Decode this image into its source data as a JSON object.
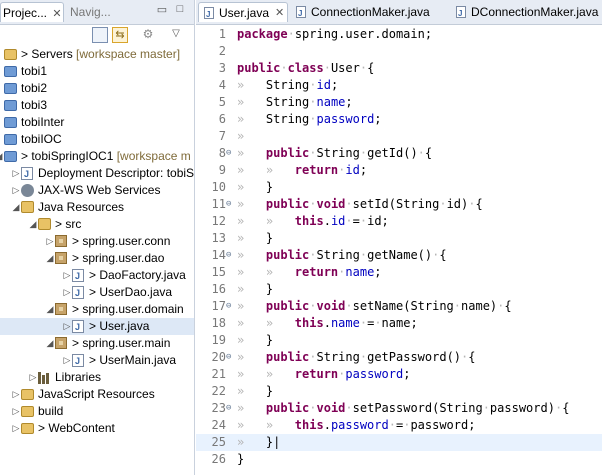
{
  "left_panel": {
    "tabs": [
      {
        "label": "Projec...",
        "active": true
      },
      {
        "label": "Navig...",
        "active": false
      }
    ],
    "tree": [
      {
        "label": "Servers",
        "decoration": "[workspace master]",
        "prefix": ">",
        "indent": 0,
        "icon": "folder-y-icon",
        "twisty": "",
        "selected": false
      },
      {
        "label": "tobi1",
        "indent": 0,
        "icon": "folder-icon",
        "twisty": "",
        "selected": false
      },
      {
        "label": "tobi2",
        "indent": 0,
        "icon": "folder-icon",
        "twisty": "",
        "selected": false
      },
      {
        "label": "tobi3",
        "indent": 0,
        "icon": "folder-icon",
        "twisty": "",
        "selected": false
      },
      {
        "label": "tobiInter",
        "indent": 0,
        "icon": "folder-icon",
        "twisty": "",
        "selected": false
      },
      {
        "label": "tobiIOC",
        "indent": 0,
        "icon": "folder-icon",
        "twisty": "",
        "selected": false
      },
      {
        "label": "tobiSpringIOC1",
        "decoration": "[workspace m",
        "prefix": ">",
        "indent": 0,
        "icon": "folder-icon",
        "twisty": "expanded",
        "selected": false
      },
      {
        "label": "Deployment Descriptor: tobiS",
        "indent": 1,
        "icon": "descriptor-icon",
        "twisty": "collapsed",
        "selected": false
      },
      {
        "label": "JAX-WS Web Services",
        "indent": 1,
        "icon": "gear-icon",
        "twisty": "collapsed",
        "selected": false
      },
      {
        "label": "Java Resources",
        "indent": 1,
        "icon": "java-resources-icon",
        "twisty": "expanded",
        "selected": false
      },
      {
        "label": "src",
        "prefix": ">",
        "indent": 2,
        "icon": "src-folder-icon",
        "twisty": "expanded",
        "selected": false
      },
      {
        "label": "spring.user.conn",
        "prefix": ">",
        "indent": 3,
        "icon": "package-icon",
        "twisty": "collapsed",
        "selected": false
      },
      {
        "label": "spring.user.dao",
        "prefix": ">",
        "indent": 3,
        "icon": "package-icon",
        "twisty": "expanded",
        "selected": false
      },
      {
        "label": "DaoFactory.java",
        "prefix": ">",
        "indent": 4,
        "icon": "java-file-icon",
        "twisty": "collapsed",
        "selected": false
      },
      {
        "label": "UserDao.java",
        "prefix": ">",
        "indent": 4,
        "icon": "java-file-icon",
        "twisty": "collapsed",
        "selected": false
      },
      {
        "label": "spring.user.domain",
        "prefix": ">",
        "indent": 3,
        "icon": "package-icon",
        "twisty": "expanded",
        "selected": false
      },
      {
        "label": "User.java",
        "prefix": ">",
        "indent": 4,
        "icon": "java-file-icon",
        "twisty": "collapsed",
        "selected": true
      },
      {
        "label": "spring.user.main",
        "prefix": ">",
        "indent": 3,
        "icon": "package-icon",
        "twisty": "expanded",
        "selected": false
      },
      {
        "label": "UserMain.java",
        "prefix": ">",
        "indent": 4,
        "icon": "java-file-icon",
        "twisty": "collapsed",
        "selected": false
      },
      {
        "label": "Libraries",
        "indent": 2,
        "icon": "libraries-icon",
        "twisty": "collapsed",
        "selected": false
      },
      {
        "label": "JavaScript Resources",
        "indent": 1,
        "icon": "js-resources-icon",
        "twisty": "collapsed",
        "selected": false
      },
      {
        "label": "build",
        "indent": 1,
        "icon": "folder-y-icon",
        "twisty": "collapsed",
        "selected": false
      },
      {
        "label": "WebContent",
        "prefix": ">",
        "indent": 1,
        "icon": "folder-y-icon",
        "twisty": "collapsed",
        "selected": false
      }
    ]
  },
  "editor": {
    "tabs": [
      {
        "label": "User.java",
        "active": true
      },
      {
        "label": "ConnectionMaker.java",
        "active": false
      },
      {
        "label": "DConnectionMaker.java",
        "active": false
      }
    ],
    "current_line": 25,
    "lines": [
      {
        "n": 1,
        "tokens": [
          [
            "kw",
            "package"
          ],
          [
            "ws",
            "·"
          ],
          [
            "p",
            "spring.user.domain;"
          ]
        ]
      },
      {
        "n": 2,
        "tokens": []
      },
      {
        "n": 3,
        "tokens": [
          [
            "kw",
            "public"
          ],
          [
            "ws",
            "·"
          ],
          [
            "kw",
            "class"
          ],
          [
            "ws",
            "·"
          ],
          [
            "p",
            "User"
          ],
          [
            "ws",
            "·"
          ],
          [
            "p",
            "{"
          ]
        ]
      },
      {
        "n": 4,
        "tokens": [
          [
            "ws",
            "»   "
          ],
          [
            "p",
            "String"
          ],
          [
            "ws",
            "·"
          ],
          [
            "fld",
            "id"
          ],
          [
            "p",
            ";"
          ]
        ]
      },
      {
        "n": 5,
        "tokens": [
          [
            "ws",
            "»   "
          ],
          [
            "p",
            "String"
          ],
          [
            "ws",
            "·"
          ],
          [
            "fld",
            "name"
          ],
          [
            "p",
            ";"
          ]
        ]
      },
      {
        "n": 6,
        "tokens": [
          [
            "ws",
            "»   "
          ],
          [
            "p",
            "String"
          ],
          [
            "ws",
            "·"
          ],
          [
            "fld",
            "password"
          ],
          [
            "p",
            ";"
          ]
        ]
      },
      {
        "n": 7,
        "tokens": [
          [
            "ws",
            "»   "
          ]
        ]
      },
      {
        "n": 8,
        "fold": true,
        "tokens": [
          [
            "ws",
            "»   "
          ],
          [
            "kw",
            "public"
          ],
          [
            "ws",
            "·"
          ],
          [
            "p",
            "String"
          ],
          [
            "ws",
            "·"
          ],
          [
            "p",
            "getId()"
          ],
          [
            "ws",
            "·"
          ],
          [
            "p",
            "{"
          ]
        ]
      },
      {
        "n": 9,
        "tokens": [
          [
            "ws",
            "»   »   "
          ],
          [
            "kw",
            "return"
          ],
          [
            "ws",
            "·"
          ],
          [
            "fld",
            "id"
          ],
          [
            "p",
            ";"
          ]
        ]
      },
      {
        "n": 10,
        "tokens": [
          [
            "ws",
            "»   "
          ],
          [
            "p",
            "}"
          ]
        ]
      },
      {
        "n": 11,
        "fold": true,
        "tokens": [
          [
            "ws",
            "»   "
          ],
          [
            "kw",
            "public"
          ],
          [
            "ws",
            "·"
          ],
          [
            "kw",
            "void"
          ],
          [
            "ws",
            "·"
          ],
          [
            "p",
            "setId(String"
          ],
          [
            "ws",
            "·"
          ],
          [
            "p",
            "id)"
          ],
          [
            "ws",
            "·"
          ],
          [
            "p",
            "{"
          ]
        ]
      },
      {
        "n": 12,
        "tokens": [
          [
            "ws",
            "»   »   "
          ],
          [
            "kw",
            "this"
          ],
          [
            "p",
            "."
          ],
          [
            "fld",
            "id"
          ],
          [
            "ws",
            "·"
          ],
          [
            "p",
            "="
          ],
          [
            "ws",
            "·"
          ],
          [
            "p",
            "id;"
          ]
        ]
      },
      {
        "n": 13,
        "tokens": [
          [
            "ws",
            "»   "
          ],
          [
            "p",
            "}"
          ]
        ]
      },
      {
        "n": 14,
        "fold": true,
        "tokens": [
          [
            "ws",
            "»   "
          ],
          [
            "kw",
            "public"
          ],
          [
            "ws",
            "·"
          ],
          [
            "p",
            "String"
          ],
          [
            "ws",
            "·"
          ],
          [
            "p",
            "getName()"
          ],
          [
            "ws",
            "·"
          ],
          [
            "p",
            "{"
          ]
        ]
      },
      {
        "n": 15,
        "tokens": [
          [
            "ws",
            "»   »   "
          ],
          [
            "kw",
            "return"
          ],
          [
            "ws",
            "·"
          ],
          [
            "fld",
            "name"
          ],
          [
            "p",
            ";"
          ]
        ]
      },
      {
        "n": 16,
        "tokens": [
          [
            "ws",
            "»   "
          ],
          [
            "p",
            "}"
          ]
        ]
      },
      {
        "n": 17,
        "fold": true,
        "tokens": [
          [
            "ws",
            "»   "
          ],
          [
            "kw",
            "public"
          ],
          [
            "ws",
            "·"
          ],
          [
            "kw",
            "void"
          ],
          [
            "ws",
            "·"
          ],
          [
            "p",
            "setName(String"
          ],
          [
            "ws",
            "·"
          ],
          [
            "p",
            "name)"
          ],
          [
            "ws",
            "·"
          ],
          [
            "p",
            "{"
          ]
        ]
      },
      {
        "n": 18,
        "tokens": [
          [
            "ws",
            "»   »   "
          ],
          [
            "kw",
            "this"
          ],
          [
            "p",
            "."
          ],
          [
            "fld",
            "name"
          ],
          [
            "ws",
            "·"
          ],
          [
            "p",
            "="
          ],
          [
            "ws",
            "·"
          ],
          [
            "p",
            "name;"
          ]
        ]
      },
      {
        "n": 19,
        "tokens": [
          [
            "ws",
            "»   "
          ],
          [
            "p",
            "}"
          ]
        ]
      },
      {
        "n": 20,
        "fold": true,
        "tokens": [
          [
            "ws",
            "»   "
          ],
          [
            "kw",
            "public"
          ],
          [
            "ws",
            "·"
          ],
          [
            "p",
            "String"
          ],
          [
            "ws",
            "·"
          ],
          [
            "p",
            "getPassword()"
          ],
          [
            "ws",
            "·"
          ],
          [
            "p",
            "{"
          ]
        ]
      },
      {
        "n": 21,
        "tokens": [
          [
            "ws",
            "»   »   "
          ],
          [
            "kw",
            "return"
          ],
          [
            "ws",
            "·"
          ],
          [
            "fld",
            "password"
          ],
          [
            "p",
            ";"
          ]
        ]
      },
      {
        "n": 22,
        "tokens": [
          [
            "ws",
            "»   "
          ],
          [
            "p",
            "}"
          ]
        ]
      },
      {
        "n": 23,
        "fold": true,
        "tokens": [
          [
            "ws",
            "»   "
          ],
          [
            "kw",
            "public"
          ],
          [
            "ws",
            "·"
          ],
          [
            "kw",
            "void"
          ],
          [
            "ws",
            "·"
          ],
          [
            "p",
            "setPassword(String"
          ],
          [
            "ws",
            "·"
          ],
          [
            "p",
            "password)"
          ],
          [
            "ws",
            "·"
          ],
          [
            "p",
            "{"
          ]
        ]
      },
      {
        "n": 24,
        "tokens": [
          [
            "ws",
            "»   »   "
          ],
          [
            "kw",
            "this"
          ],
          [
            "p",
            "."
          ],
          [
            "fld",
            "password"
          ],
          [
            "ws",
            "·"
          ],
          [
            "p",
            "="
          ],
          [
            "ws",
            "·"
          ],
          [
            "p",
            "password;"
          ]
        ]
      },
      {
        "n": 25,
        "tokens": [
          [
            "ws",
            "»   "
          ],
          [
            "p",
            "}"
          ]
        ]
      },
      {
        "n": 26,
        "tokens": [
          [
            "p",
            "}"
          ]
        ]
      }
    ]
  },
  "colors": {
    "keyword": "#7f0055",
    "field": "#0000c0",
    "whitespace_marker": "#b5b5b5",
    "line_number": "#787878",
    "selection": "#dde8f6",
    "current_line": "#e8f2fe",
    "tab_bar": "#e7ecf4"
  }
}
